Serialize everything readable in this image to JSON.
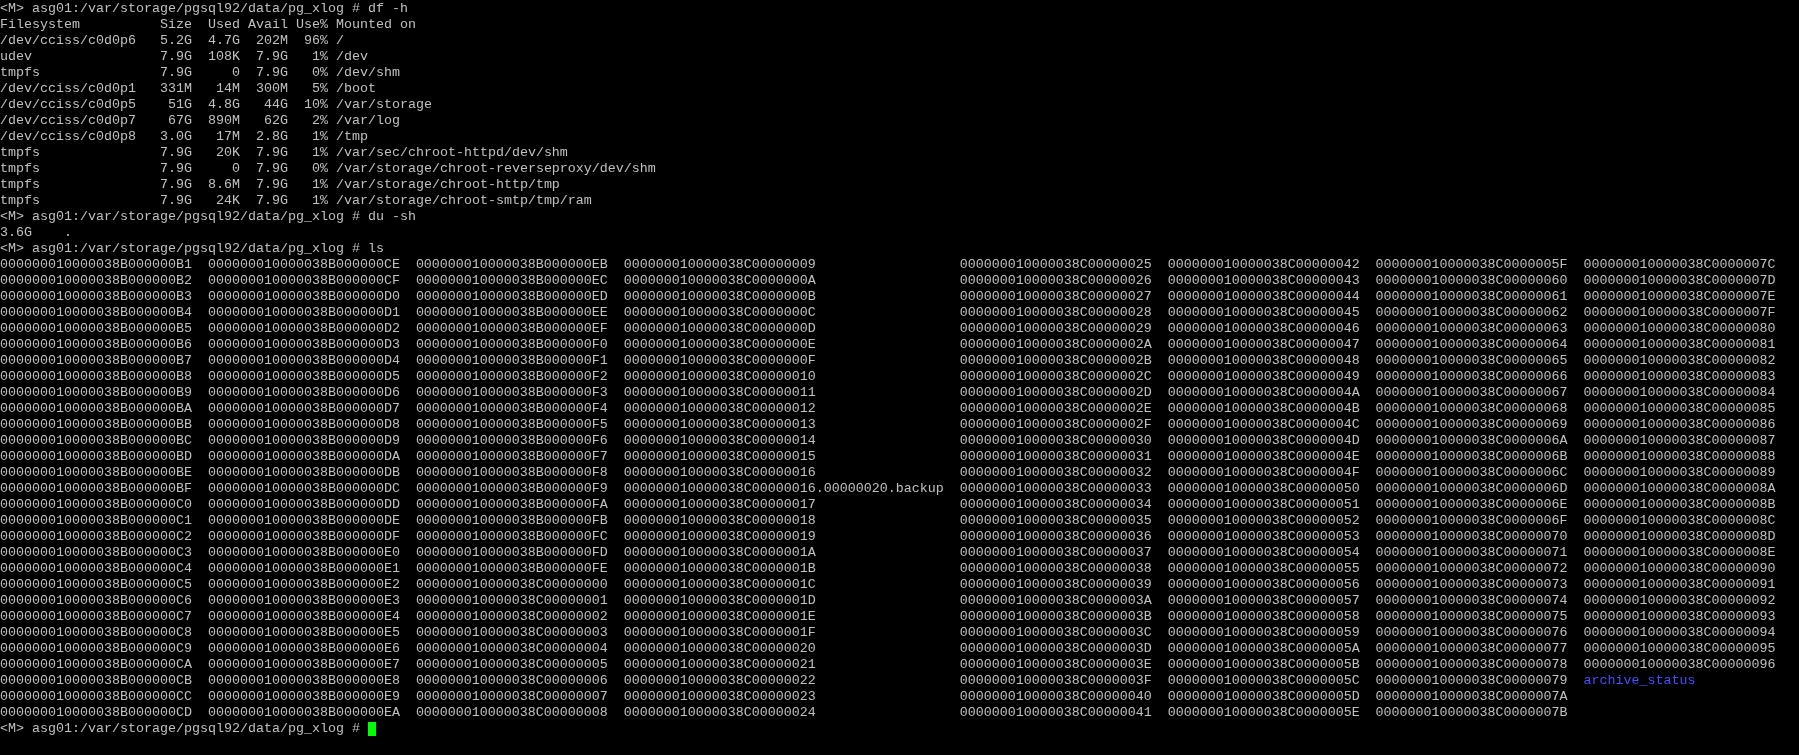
{
  "terminal": {
    "lines": [
      "<M> asg01:/var/storage/pgsql92/data/pg_xlog # df -h",
      "Filesystem          Size  Used Avail Use% Mounted on",
      "/dev/cciss/c0d0p6   5.2G  4.7G  202M  96% /",
      "udev                7.9G  108K  7.9G   1% /dev",
      "tmpfs               7.9G     0  7.9G   0% /dev/shm",
      "/dev/cciss/c0d0p1   331M   14M  300M   5% /boot",
      "/dev/cciss/c0d0p5    51G  4.8G   44G  10% /var/storage",
      "/dev/cciss/c0d0p7    67G  890M   62G   2% /var/log",
      "/dev/cciss/c0d0p8   3.0G   17M  2.8G   1% /tmp",
      "tmpfs               7.9G   20K  7.9G   1% /var/sec/chroot-httpd/dev/shm",
      "tmpfs               7.9G     0  7.9G   0% /var/storage/chroot-reverseproxy/dev/shm",
      "tmpfs               7.9G  8.6M  7.9G   1% /var/storage/chroot-http/tmp",
      "tmpfs               7.9G   24K  7.9G   1% /var/storage/chroot-smtp/tmp/ram",
      "<M> asg01:/var/storage/pgsql92/data/pg_xlog # du -sh",
      "3.6G    .",
      "<M> asg01:/var/storage/pgsql92/data/pg_xlog # ls"
    ],
    "ls_columns": [
      [
        "000000010000038B000000B1",
        "000000010000038B000000B2",
        "000000010000038B000000B3",
        "000000010000038B000000B4",
        "000000010000038B000000B5",
        "000000010000038B000000B6",
        "000000010000038B000000B7",
        "000000010000038B000000B8",
        "000000010000038B000000B9",
        "000000010000038B000000BA",
        "000000010000038B000000BB",
        "000000010000038B000000BC",
        "000000010000038B000000BD",
        "000000010000038B000000BE",
        "000000010000038B000000BF",
        "000000010000038B000000C0",
        "000000010000038B000000C1",
        "000000010000038B000000C2",
        "000000010000038B000000C3",
        "000000010000038B000000C4",
        "000000010000038B000000C5",
        "000000010000038B000000C6",
        "000000010000038B000000C7",
        "000000010000038B000000C8",
        "000000010000038B000000C9",
        "000000010000038B000000CA",
        "000000010000038B000000CB",
        "000000010000038B000000CC",
        "000000010000038B000000CD"
      ],
      [
        "000000010000038B000000CE",
        "000000010000038B000000CF",
        "000000010000038B000000D0",
        "000000010000038B000000D1",
        "000000010000038B000000D2",
        "000000010000038B000000D3",
        "000000010000038B000000D4",
        "000000010000038B000000D5",
        "000000010000038B000000D6",
        "000000010000038B000000D7",
        "000000010000038B000000D8",
        "000000010000038B000000D9",
        "000000010000038B000000DA",
        "000000010000038B000000DB",
        "000000010000038B000000DC",
        "000000010000038B000000DD",
        "000000010000038B000000DE",
        "000000010000038B000000DF",
        "000000010000038B000000E0",
        "000000010000038B000000E1",
        "000000010000038B000000E2",
        "000000010000038B000000E3",
        "000000010000038B000000E4",
        "000000010000038B000000E5",
        "000000010000038B000000E6",
        "000000010000038B000000E7",
        "000000010000038B000000E8",
        "000000010000038B000000E9",
        "000000010000038B000000EA"
      ],
      [
        "000000010000038B000000EB",
        "000000010000038B000000EC",
        "000000010000038B000000ED",
        "000000010000038B000000EE",
        "000000010000038B000000EF",
        "000000010000038B000000F0",
        "000000010000038B000000F1",
        "000000010000038B000000F2",
        "000000010000038B000000F3",
        "000000010000038B000000F4",
        "000000010000038B000000F5",
        "000000010000038B000000F6",
        "000000010000038B000000F7",
        "000000010000038B000000F8",
        "000000010000038B000000F9",
        "000000010000038B000000FA",
        "000000010000038B000000FB",
        "000000010000038B000000FC",
        "000000010000038B000000FD",
        "000000010000038B000000FE",
        "000000010000038C00000000",
        "000000010000038C00000001",
        "000000010000038C00000002",
        "000000010000038C00000003",
        "000000010000038C00000004",
        "000000010000038C00000005",
        "000000010000038C00000006",
        "000000010000038C00000007",
        "000000010000038C00000008"
      ],
      [
        "000000010000038C00000009",
        "000000010000038C0000000A",
        "000000010000038C0000000B",
        "000000010000038C0000000C",
        "000000010000038C0000000D",
        "000000010000038C0000000E",
        "000000010000038C0000000F",
        "000000010000038C00000010",
        "000000010000038C00000011",
        "000000010000038C00000012",
        "000000010000038C00000013",
        "000000010000038C00000014",
        "000000010000038C00000015",
        "000000010000038C00000016",
        "000000010000038C00000016.00000020.backup",
        "000000010000038C00000017",
        "000000010000038C00000018",
        "000000010000038C00000019",
        "000000010000038C0000001A",
        "000000010000038C0000001B",
        "000000010000038C0000001C",
        "000000010000038C0000001D",
        "000000010000038C0000001E",
        "000000010000038C0000001F",
        "000000010000038C00000020",
        "000000010000038C00000021",
        "000000010000038C00000022",
        "000000010000038C00000023",
        "000000010000038C00000024"
      ],
      [
        "000000010000038C00000025",
        "000000010000038C00000026",
        "000000010000038C00000027",
        "000000010000038C00000028",
        "000000010000038C00000029",
        "000000010000038C0000002A",
        "000000010000038C0000002B",
        "000000010000038C0000002C",
        "000000010000038C0000002D",
        "000000010000038C0000002E",
        "000000010000038C0000002F",
        "000000010000038C00000030",
        "000000010000038C00000031",
        "000000010000038C00000032",
        "000000010000038C00000033",
        "000000010000038C00000034",
        "000000010000038C00000035",
        "000000010000038C00000036",
        "000000010000038C00000037",
        "000000010000038C00000038",
        "000000010000038C00000039",
        "000000010000038C0000003A",
        "000000010000038C0000003B",
        "000000010000038C0000003C",
        "000000010000038C0000003D",
        "000000010000038C0000003E",
        "000000010000038C0000003F",
        "000000010000038C00000040",
        "000000010000038C00000041"
      ],
      [
        "000000010000038C00000042",
        "000000010000038C00000043",
        "000000010000038C00000044",
        "000000010000038C00000045",
        "000000010000038C00000046",
        "000000010000038C00000047",
        "000000010000038C00000048",
        "000000010000038C00000049",
        "000000010000038C0000004A",
        "000000010000038C0000004B",
        "000000010000038C0000004C",
        "000000010000038C0000004D",
        "000000010000038C0000004E",
        "000000010000038C0000004F",
        "000000010000038C00000050",
        "000000010000038C00000051",
        "000000010000038C00000052",
        "000000010000038C00000053",
        "000000010000038C00000054",
        "000000010000038C00000055",
        "000000010000038C00000056",
        "000000010000038C00000057",
        "000000010000038C00000058",
        "000000010000038C00000059",
        "000000010000038C0000005A",
        "000000010000038C0000005B",
        "000000010000038C0000005C",
        "000000010000038C0000005D",
        "000000010000038C0000005E"
      ],
      [
        "000000010000038C0000005F",
        "000000010000038C00000060",
        "000000010000038C00000061",
        "000000010000038C00000062",
        "000000010000038C00000063",
        "000000010000038C00000064",
        "000000010000038C00000065",
        "000000010000038C00000066",
        "000000010000038C00000067",
        "000000010000038C00000068",
        "000000010000038C00000069",
        "000000010000038C0000006A",
        "000000010000038C0000006B",
        "000000010000038C0000006C",
        "000000010000038C0000006D",
        "000000010000038C0000006E",
        "000000010000038C0000006F",
        "000000010000038C00000070",
        "000000010000038C00000071",
        "000000010000038C00000072",
        "000000010000038C00000073",
        "000000010000038C00000074",
        "000000010000038C00000075",
        "000000010000038C00000076",
        "000000010000038C00000077",
        "000000010000038C00000078",
        "000000010000038C00000079",
        "000000010000038C0000007A",
        "000000010000038C0000007B"
      ],
      [
        "000000010000038C0000007C",
        "000000010000038C0000007D",
        "000000010000038C0000007E",
        "000000010000038C0000007F",
        "000000010000038C00000080",
        "000000010000038C00000081",
        "000000010000038C00000082",
        "000000010000038C00000083",
        "000000010000038C00000084",
        "000000010000038C00000085",
        "000000010000038C00000086",
        "000000010000038C00000087",
        "000000010000038C00000088",
        "000000010000038C00000089",
        "000000010000038C0000008A",
        "000000010000038C0000008B",
        "000000010000038C0000008C",
        "000000010000038C0000008D",
        "000000010000038C0000008E",
        "000000010000038C00000090",
        "000000010000038C00000091",
        "000000010000038C00000092",
        "000000010000038C00000093",
        "000000010000038C00000094",
        "000000010000038C00000095",
        "000000010000038C00000096",
        {
          "name": "archive_status",
          "kind": "directory"
        }
      ]
    ],
    "prompt": "<M> asg01:/var/storage/pgsql92/data/pg_xlog #",
    "cursor": true
  }
}
